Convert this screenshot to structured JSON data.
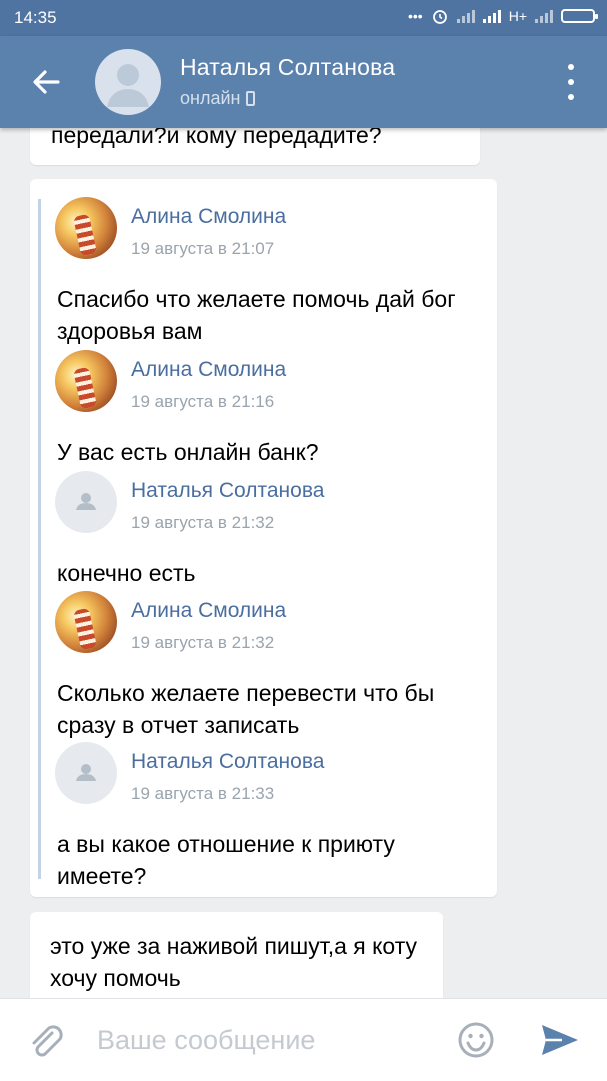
{
  "status_bar": {
    "time": "14:35",
    "network": "H+"
  },
  "header": {
    "name": "Наталья Солтанова",
    "status": "онлайн"
  },
  "messages": {
    "top_partial": "передали?и кому передадите?",
    "forwarded": [
      {
        "author": "Алина Смолина",
        "date": "19 августа в 21:07",
        "text": "Спасибо что желаете помочь дай бог здоровья вам",
        "avatar": "photo"
      },
      {
        "author": "Алина Смолина",
        "date": "19 августа в 21:16",
        "text": "У вас есть онлайн банк?",
        "avatar": "photo"
      },
      {
        "author": "Наталья Солтанова",
        "date": "19 августа в 21:32",
        "text": "конечно есть",
        "avatar": "default"
      },
      {
        "author": "Алина Смолина",
        "date": "19 августа в 21:32",
        "text": "Сколько желаете перевести что бы сразу в отчет записать",
        "avatar": "photo"
      },
      {
        "author": "Наталья Солтанова",
        "date": "19 августа в 21:33",
        "text": "а вы какое отношение к приюту имеете?",
        "avatar": "default"
      }
    ],
    "bottom": "это уже за наживой пишут,а я коту хочу помочь"
  },
  "input": {
    "placeholder": "Ваше сообщение"
  },
  "colors": {
    "header": "#5b81ad",
    "status_bar": "#4f74a1",
    "link": "#4a6ea0",
    "background": "#edeef0"
  }
}
